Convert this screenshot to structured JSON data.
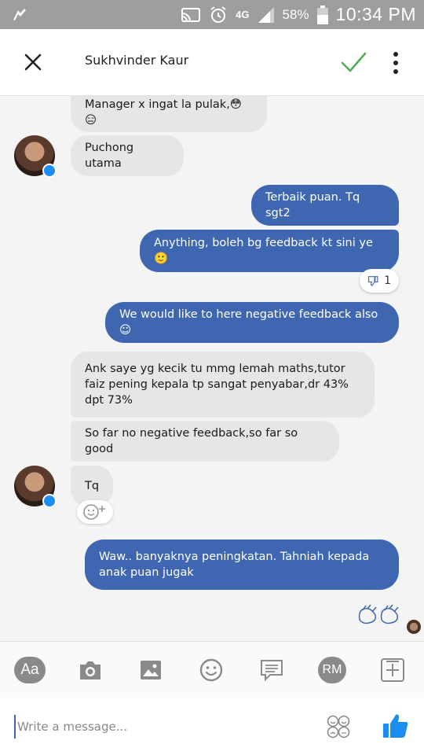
{
  "status_bar": {
    "battery": "58%",
    "time": "10:34 PM",
    "network": "4G"
  },
  "header": {
    "contact_name": "Sukhvinder Kaur"
  },
  "messages": [
    {
      "direction": "in",
      "text": "Manager x ingat la pulak,😳😑"
    },
    {
      "direction": "in",
      "text": "Puchong utama"
    },
    {
      "direction": "out",
      "text": "Terbaik puan. Tq sgt2"
    },
    {
      "direction": "out",
      "text": "Anything, boleh bg feedback kt sini ye 🙂"
    },
    {
      "direction": "out",
      "text": "We would like to here negative feedback also ☺"
    },
    {
      "direction": "in",
      "text": "Ank saye yg kecik tu mmg lemah maths,tutor faiz pening kepala tp sangat penyabar,dr 43% dpt 73%"
    },
    {
      "direction": "in",
      "text": "So far no negative feedback,so far so good"
    },
    {
      "direction": "in",
      "text": "Tq"
    },
    {
      "direction": "out",
      "text": "Waw.. banyaknya peningkatan. Tahniah kepada anak puan jugak"
    }
  ],
  "reactions": {
    "dislike_count": "1"
  },
  "toolbar": {
    "aa_label": "Aa",
    "rm_label": "RM"
  },
  "composer": {
    "placeholder": "Write a message..."
  },
  "colors": {
    "outgoing_bubble": "#3f67b1",
    "incoming_bubble": "#e6e6e6",
    "status_bar": "#9e9e9e",
    "check_green": "#4caf50",
    "like_blue": "#1c8ef2"
  }
}
